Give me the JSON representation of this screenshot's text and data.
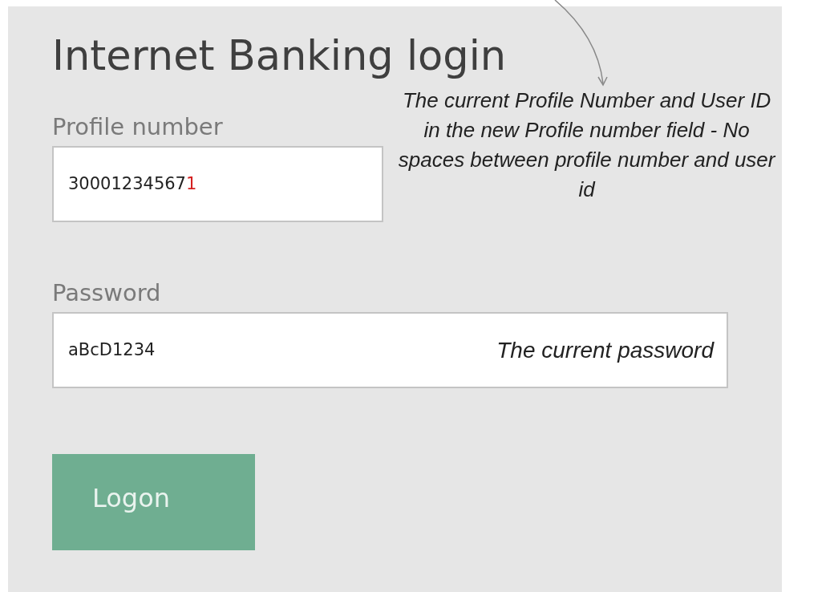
{
  "form": {
    "title": "Internet Banking login",
    "fields": [
      {
        "label": "Profile number",
        "value": "30001234567",
        "highlight": "1",
        "annotation": "The current Profile Number and User ID in the new Profile number field - No spaces between profile number and user id",
        "kind": "profile"
      },
      {
        "label": "Password",
        "value": "aBcD1234",
        "annotation": "The current password",
        "kind": "password"
      }
    ],
    "button": "Logon"
  }
}
